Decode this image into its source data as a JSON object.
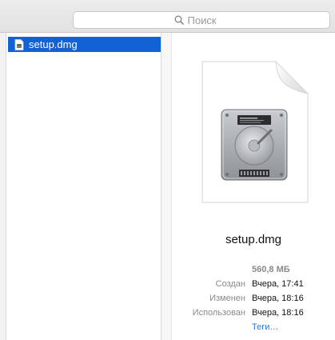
{
  "search": {
    "placeholder": "Поиск"
  },
  "column": {
    "items": [
      {
        "label": "setup.dmg",
        "selected": true
      }
    ]
  },
  "preview": {
    "file_name": "setup.dmg",
    "icon": "disk-image-icon",
    "size": "560,8 МБ",
    "meta": [
      {
        "key": "Создан",
        "value": "Вчера, 17:41"
      },
      {
        "key": "Изменен",
        "value": "Вчера, 18:16"
      },
      {
        "key": "Использован",
        "value": "Вчера, 18:16"
      }
    ],
    "tags_link": "Теги…"
  },
  "colors": {
    "selection": "#1262d6",
    "link": "#2f72d8",
    "muted_text": "#8a8a8a"
  }
}
